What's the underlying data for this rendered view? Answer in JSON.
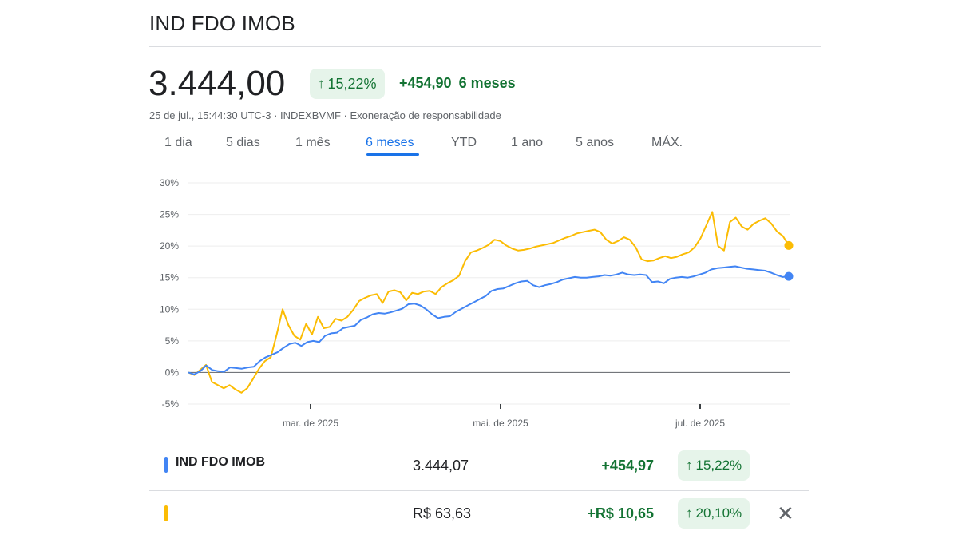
{
  "header": {
    "title": "IND FDO IMOB",
    "price": "3.444,00",
    "change_pct": "15,22%",
    "change_abs": "+454,90",
    "change_period": "6 meses",
    "arrow_icon": "arrow-up-icon"
  },
  "meta": {
    "timestamp": "25 de jul., 15:44:30 UTC-3",
    "separator1": " · ",
    "exchange": "INDEXBVMF",
    "separator2": " · ",
    "disclaimer": "Exoneração de responsabilidade"
  },
  "tabs": [
    {
      "label": "1 dia"
    },
    {
      "label": "5 dias"
    },
    {
      "label": "1 mês"
    },
    {
      "label": "6 meses",
      "active": true
    },
    {
      "label": "YTD"
    },
    {
      "label": "1 ano"
    },
    {
      "label": "5 anos"
    },
    {
      "label": "MÁX."
    }
  ],
  "colors": {
    "blue": "#4285f4",
    "yellow": "#fbbc04",
    "green": "#137333",
    "green_bg": "#e6f4ea",
    "accent": "#1a73e8"
  },
  "chart_data": {
    "type": "line",
    "y_unit": "%",
    "ylim": [
      -5,
      30
    ],
    "yticks": [
      "30%",
      "25%",
      "20%",
      "15%",
      "10%",
      "5%",
      "0%",
      "-5%"
    ],
    "xticks": [
      "mar. de 2025",
      "mai. de 2025",
      "jul. de 2025"
    ],
    "grid": true,
    "series": [
      {
        "name": "IND FDO IMOB",
        "color": "#4285f4",
        "values": [
          0,
          -0.3,
          0.2,
          1.1,
          0.4,
          0.2,
          0.1,
          0.8,
          0.7,
          0.6,
          0.8,
          0.9,
          1.8,
          2.4,
          2.8,
          3.2,
          3.9,
          4.5,
          4.7,
          4.2,
          4.8,
          5.0,
          4.8,
          5.8,
          6.2,
          6.3,
          7.0,
          7.2,
          7.4,
          8.3,
          8.7,
          9.2,
          9.4,
          9.3,
          9.5,
          9.8,
          10.1,
          10.8,
          10.9,
          10.6,
          10.0,
          9.2,
          8.6,
          8.8,
          8.9,
          9.6,
          10.1,
          10.6,
          11.1,
          11.6,
          12.1,
          12.9,
          13.2,
          13.3,
          13.7,
          14.1,
          14.4,
          14.5,
          13.8,
          13.5,
          13.8,
          14.0,
          14.3,
          14.7,
          14.9,
          15.1,
          15.0,
          15.0,
          15.1,
          15.2,
          15.4,
          15.3,
          15.5,
          15.8,
          15.5,
          15.4,
          15.5,
          15.4,
          14.3,
          14.4,
          14.1,
          14.8,
          15.0,
          15.1,
          15.0,
          15.2,
          15.5,
          15.8,
          16.3,
          16.5,
          16.6,
          16.7,
          16.8,
          16.6,
          16.4,
          16.3,
          16.2,
          16.1,
          15.8,
          15.4,
          15.1,
          15.2
        ]
      },
      {
        "name": "",
        "color": "#fbbc04",
        "values": [
          0,
          -0.4,
          0.4,
          1.2,
          -1.5,
          -2.0,
          -2.5,
          -2.0,
          -2.7,
          -3.2,
          -2.5,
          -1.0,
          0.6,
          1.8,
          2.4,
          6.0,
          10.0,
          7.5,
          5.8,
          5.2,
          7.7,
          6.0,
          8.8,
          7.0,
          7.2,
          8.5,
          8.2,
          8.8,
          9.9,
          11.3,
          11.8,
          12.2,
          12.4,
          11.0,
          12.8,
          13.0,
          12.7,
          11.4,
          12.6,
          12.4,
          12.8,
          12.9,
          12.4,
          13.5,
          14.1,
          14.6,
          15.3,
          17.6,
          19.0,
          19.3,
          19.7,
          20.2,
          21.0,
          20.8,
          20.1,
          19.6,
          19.3,
          19.4,
          19.6,
          19.9,
          20.1,
          20.3,
          20.5,
          20.9,
          21.3,
          21.6,
          22.0,
          22.2,
          22.4,
          22.6,
          22.2,
          21.0,
          20.4,
          20.8,
          21.4,
          21.0,
          19.8,
          17.9,
          17.6,
          17.7,
          18.1,
          18.4,
          18.1,
          18.3,
          18.7,
          19.0,
          19.8,
          21.2,
          23.3,
          25.4,
          20.0,
          19.3,
          23.8,
          24.5,
          23.1,
          22.6,
          23.5,
          24.0,
          24.4,
          23.6,
          22.3,
          21.6,
          20.1
        ]
      }
    ]
  },
  "table": {
    "rows": [
      {
        "name": "IND FDO IMOB",
        "value": "3.444,07",
        "change": "+454,97",
        "change_pct": "15,22%",
        "color": "#4285f4"
      },
      {
        "name": "",
        "value": "R$ 63,63",
        "change": "+R$ 10,65",
        "change_pct": "20,10%",
        "color": "#fbbc04"
      }
    ],
    "close_icon": "close-icon"
  }
}
